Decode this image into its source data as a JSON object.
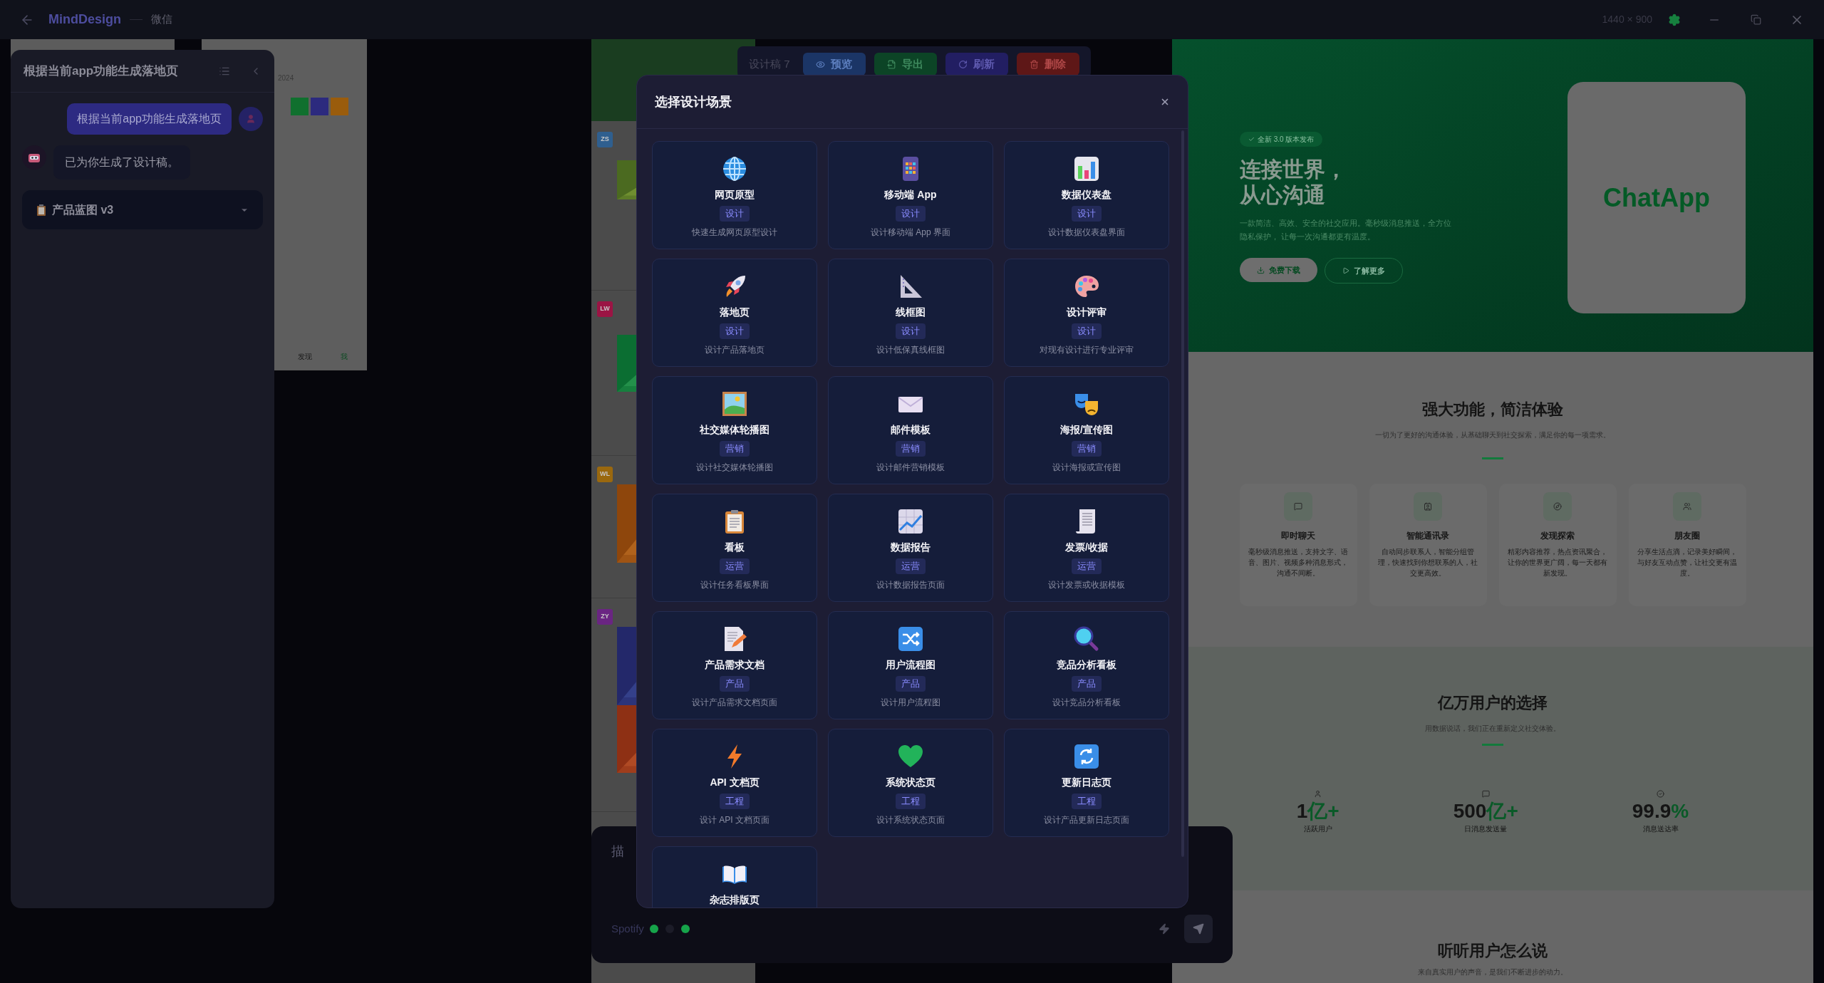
{
  "top_bar": {
    "app_name": "MindDesign",
    "project": "微信",
    "resolution": "1440 × 900"
  },
  "phone_preview": {
    "date": "2024",
    "nav": [
      "发现",
      "我"
    ]
  },
  "chat_panel": {
    "title": "根据当前app功能生成落地页",
    "messages": [
      {
        "kind": "user",
        "text": "根据当前app功能生成落地页"
      },
      {
        "kind": "assistant",
        "text": "已为你生成了设计稿。"
      }
    ],
    "artifact": {
      "title": "产品蓝图 v3"
    }
  },
  "feed": {
    "posts": [
      {
        "avatar": "ZS",
        "color": "#2f5f8f"
      },
      {
        "avatar": "LW",
        "color": "#9b1444"
      },
      {
        "avatar": "WL",
        "color": "#9a680e"
      },
      {
        "avatar": "ZY",
        "color": "#6a2582"
      }
    ]
  },
  "toolbar": {
    "label": "设计稿 7",
    "buttons": [
      {
        "label": "预览",
        "kind": "preview"
      },
      {
        "label": "导出",
        "kind": "export"
      },
      {
        "label": "刷新",
        "kind": "refresh"
      },
      {
        "label": "删除",
        "kind": "delete"
      }
    ]
  },
  "composer": {
    "placeholder": "描",
    "model": "Spotify",
    "dots": [
      {
        "color": "#16a34a"
      },
      {
        "color": "#1c1c28"
      },
      {
        "color": "#16a34a"
      }
    ]
  },
  "modal": {
    "title": "选择设计场景",
    "scenes": [
      {
        "title": "网页原型",
        "tag": "设计",
        "description": "快速生成网页原型设计"
      },
      {
        "title": "移动端 App",
        "tag": "设计",
        "description": "设计移动端 App 界面"
      },
      {
        "title": "数据仪表盘",
        "tag": "设计",
        "description": "设计数据仪表盘界面"
      },
      {
        "title": "落地页",
        "tag": "设计",
        "description": "设计产品落地页"
      },
      {
        "title": "线框图",
        "tag": "设计",
        "description": "设计低保真线框图"
      },
      {
        "title": "设计评审",
        "tag": "设计",
        "description": "对现有设计进行专业评审"
      },
      {
        "title": "社交媒体轮播图",
        "tag": "营销",
        "description": "设计社交媒体轮播图"
      },
      {
        "title": "邮件模板",
        "tag": "营销",
        "description": "设计邮件营销模板"
      },
      {
        "title": "海报/宣传图",
        "tag": "营销",
        "description": "设计海报或宣传图"
      },
      {
        "title": "看板",
        "tag": "运营",
        "description": "设计任务看板界面"
      },
      {
        "title": "数据报告",
        "tag": "运营",
        "description": "设计数据报告页面"
      },
      {
        "title": "发票/收据",
        "tag": "运营",
        "description": "设计发票或收据模板"
      },
      {
        "title": "产品需求文档",
        "tag": "产品",
        "description": "设计产品需求文档页面"
      },
      {
        "title": "用户流程图",
        "tag": "产品",
        "description": "设计用户流程图"
      },
      {
        "title": "竞品分析看板",
        "tag": "产品",
        "description": "设计竞品分析看板"
      },
      {
        "title": "API 文档页",
        "tag": "工程",
        "description": "设计 API 文档页面"
      },
      {
        "title": "系统状态页",
        "tag": "工程",
        "description": "设计系统状态页面"
      },
      {
        "title": "更新日志页",
        "tag": "工程",
        "description": "设计产品更新日志页面"
      },
      {
        "title": "杂志排版页"
      }
    ]
  },
  "preview": {
    "hero": {
      "badge": "全新 3.0 版本发布",
      "heading": [
        "连接世界，",
        "从心沟通"
      ],
      "body": "一款简洁、高效、安全的社交应用。毫秒级消息推送，全方位隐私保护， 让每一次沟通都更有温度。",
      "buttons": [
        {
          "label": "免费下载",
          "kind": "primary"
        },
        {
          "label": "了解更多",
          "kind": "secondary"
        }
      ],
      "logo": "ChatApp"
    },
    "features": {
      "title": "强大功能，简洁体验",
      "subtitle": "一切为了更好的沟通体验，从基础聊天到社交探索，满足你的每一项需求。",
      "items": [
        {
          "title": "即时聊天",
          "description": "毫秒级消息推送，支持文字、语音、图片、视频多种消息形式，沟通不间断。"
        },
        {
          "title": "智能通讯录",
          "description": "自动同步联系人，智能分组管理，快速找到你想联系的人，社交更高效。"
        },
        {
          "title": "发现探索",
          "description": "精彩内容推荐，热点资讯聚合，让你的世界更广阔，每一天都有新发现。"
        },
        {
          "title": "朋友圈",
          "description": "分享生活点滴，记录美好瞬间，与好友互动点赞，让社交更有温度。"
        }
      ]
    },
    "stats": {
      "title": "亿万用户的选择",
      "subtitle": "用数据说话，我们正在重新定义社交体验。",
      "items": [
        {
          "value": "1",
          "unit": "亿+",
          "label": "活跃用户"
        },
        {
          "value": "500",
          "unit": "亿+",
          "label": "日消息发送量"
        },
        {
          "value": "99.9",
          "unit": "%",
          "label": "消息送达率"
        }
      ]
    },
    "testimonials": {
      "title": "听听用户怎么说",
      "subtitle": "来自真实用户的声音，是我们不断进步的动力。"
    }
  }
}
